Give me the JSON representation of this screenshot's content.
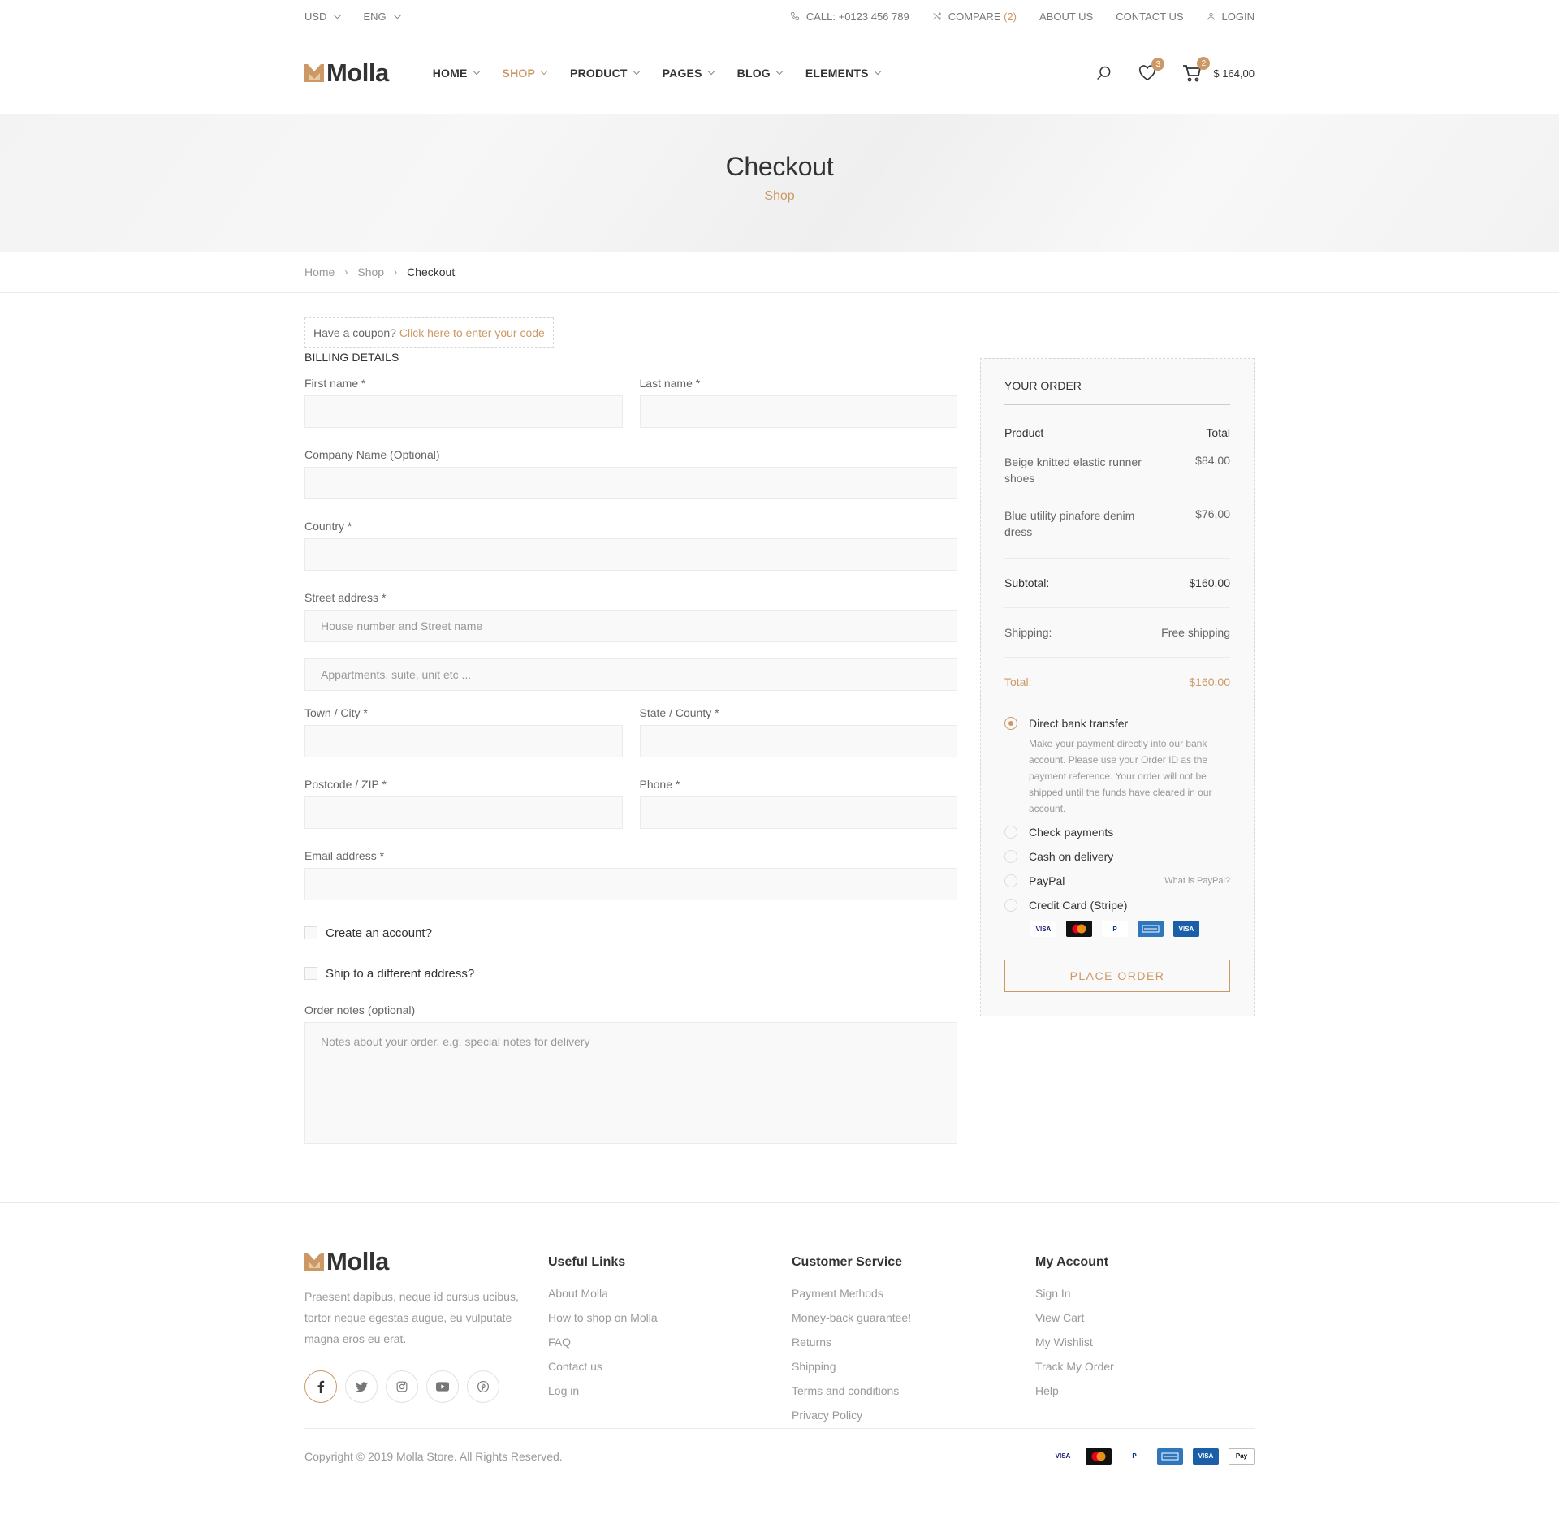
{
  "topbar": {
    "currency": "USD",
    "language": "ENG",
    "phone": "CALL: +0123 456 789",
    "compare_label": "COMPARE",
    "compare_count": "(2)",
    "about": "ABOUT US",
    "contact": "CONTACT US",
    "login": "LOGIN"
  },
  "header": {
    "logo_text": "Molla",
    "nav": [
      "HOME",
      "SHOP",
      "PRODUCT",
      "PAGES",
      "BLOG",
      "ELEMENTS"
    ],
    "active_nav": "SHOP",
    "wishlist_count": "3",
    "cart_count": "2",
    "cart_total": "$ 164,00"
  },
  "page_header": {
    "title": "Checkout",
    "subtitle": "Shop"
  },
  "breadcrumb": [
    "Home",
    "Shop",
    "Checkout"
  ],
  "coupon": {
    "text": "Have a coupon?",
    "link": "Click here to enter your code"
  },
  "billing": {
    "title": "BILLING DETAILS",
    "first_name": "First name *",
    "last_name": "Last name *",
    "company": "Company Name (Optional)",
    "country": "Country *",
    "street": "Street address *",
    "street_ph1": "House number and Street name",
    "street_ph2": "Appartments, suite, unit etc ...",
    "city": "Town / City *",
    "state": "State / County *",
    "postcode": "Postcode / ZIP *",
    "phone": "Phone *",
    "email": "Email address *",
    "create_account": "Create an account?",
    "ship_different": "Ship to a different address?",
    "notes_label": "Order notes (optional)",
    "notes_ph": "Notes about your order, e.g. special notes for delivery"
  },
  "order": {
    "title": "YOUR ORDER",
    "col_product": "Product",
    "col_total": "Total",
    "items": [
      {
        "name": "Beige knitted elastic runner shoes",
        "price": "$84,00"
      },
      {
        "name": "Blue utility pinafore denim dress",
        "price": "$76,00"
      }
    ],
    "subtotal_label": "Subtotal:",
    "subtotal": "$160.00",
    "shipping_label": "Shipping:",
    "shipping": "Free shipping",
    "total_label": "Total:",
    "total": "$160.00",
    "payments": {
      "bank": "Direct bank transfer",
      "bank_desc": "Make your payment directly into our bank account. Please use your Order ID as the payment reference. Your order will not be shipped until the funds have cleared in our account.",
      "check": "Check payments",
      "cod": "Cash on delivery",
      "paypal": "PayPal",
      "paypal_link": "What is PayPal?",
      "stripe": "Credit Card (Stripe)"
    },
    "place_order": "PLACE ORDER"
  },
  "footer": {
    "logo_text": "Molla",
    "about": "Praesent dapibus, neque id cursus ucibus, tortor neque egestas augue, eu vulputate magna eros eu erat.",
    "useful_title": "Useful Links",
    "useful": [
      "About Molla",
      "How to shop on Molla",
      "FAQ",
      "Contact us",
      "Log in"
    ],
    "service_title": "Customer Service",
    "service": [
      "Payment Methods",
      "Money-back guarantee!",
      "Returns",
      "Shipping",
      "Terms and conditions",
      "Privacy Policy"
    ],
    "account_title": "My Account",
    "account": [
      "Sign In",
      "View Cart",
      "My Wishlist",
      "Track My Order",
      "Help"
    ],
    "copyright": "Copyright © 2019 Molla Store. All Rights Reserved."
  },
  "colors": {
    "accent": "#cc9966",
    "field_bg": "#f9f9f9",
    "border": "#ebebeb"
  },
  "icons": {
    "social": [
      "facebook-icon",
      "twitter-icon",
      "instagram-icon",
      "youtube-icon",
      "pinterest-icon"
    ],
    "payment_cards": [
      "visa-icon",
      "mastercard-icon",
      "paypal-icon",
      "amex-icon",
      "visa-electron-icon",
      "apple-pay-icon"
    ]
  }
}
